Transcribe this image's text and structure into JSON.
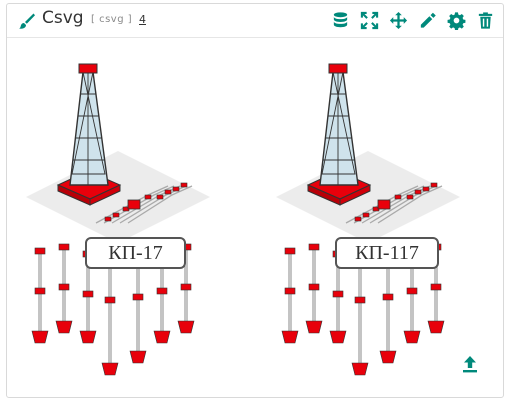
{
  "widget": {
    "title": "Csvg",
    "type_tag": "[ csvg ]",
    "count": "4",
    "accent_color": "#00897b"
  },
  "toolbar": {
    "icons": [
      "database-icon",
      "expand-icon",
      "move-icon",
      "edit-icon",
      "settings-icon",
      "delete-icon"
    ]
  },
  "platforms": [
    {
      "label": "КП-17"
    },
    {
      "label": "КП-117"
    }
  ],
  "colors": {
    "red": "#e8000b",
    "tower_fill": "#cfe3ec",
    "deck": "#ececec",
    "dark": "#333333"
  }
}
